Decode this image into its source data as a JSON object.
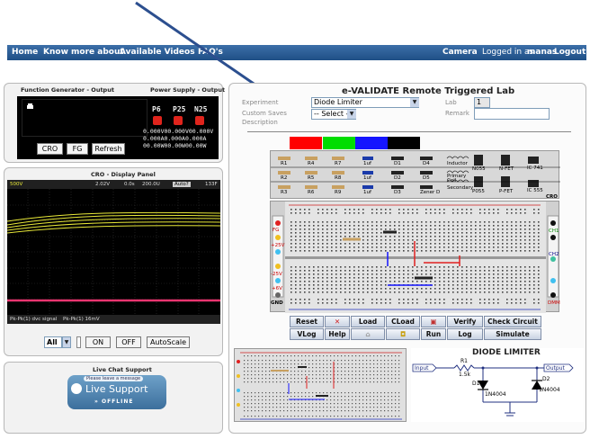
{
  "nav": {
    "home": "Home",
    "know_more": "Know more about",
    "videos": "Available Videos",
    "faq": "FAQ's",
    "camera": "Camera",
    "logged_prefix": "Logged in as",
    "user": "manas",
    "logout": "Logout"
  },
  "fg_panel": {
    "title": "Function Generator - Output",
    "ps_title": "Power Supply - Output",
    "cro_btn": "CRO",
    "fg_btn": "FG",
    "refresh_btn": "Refresh",
    "channels": [
      "P6",
      "P25",
      "N25"
    ],
    "readings": [
      [
        "0.000V",
        "00.000V",
        "00.000V"
      ],
      [
        "0.000A",
        "0.000A",
        "0.000A"
      ],
      [
        "00.00W",
        "00.00W",
        "00.00W"
      ]
    ]
  },
  "cro": {
    "title": "CRO - Display Panel",
    "header": [
      "500V",
      "2.02V",
      "0.0s",
      "200.0U",
      "Auto?",
      "133F"
    ],
    "footer_left": "Pk-Pk(1) dvc signal",
    "footer_right": "Pk-Pk(1) 16mV",
    "channel_select": "All",
    "on_btn": "ON",
    "off_btn": "OFF",
    "autoscale_btn": "AutoScale",
    "trace_yellow": "#e8e838",
    "trace_pink": "#e8356f"
  },
  "chat": {
    "title": "Live Chat Support",
    "leave_msg": "Please leave a message",
    "live_support": "Live Support",
    "offline": "OFFLINE"
  },
  "lab": {
    "title": "e-VALIDATE Remote Triggered Lab",
    "experiment_label": "Experiment",
    "experiment_value": "Diode Limiter",
    "lab_label": "Lab",
    "lab_value": "1",
    "custom_label": "Custom Saves",
    "custom_value": "-- Select --",
    "remark_label": "Remark",
    "description_label": "Description",
    "colors": [
      "#ff0000",
      "#00dd00",
      "#1515ff",
      "#000000"
    ]
  },
  "components": {
    "row1": [
      "R1",
      "R4",
      "R7",
      "1uf",
      "D1",
      "D4",
      "Inductor",
      "N055",
      "N-FET",
      "IC 741"
    ],
    "row2": [
      "R2",
      "R5",
      "R8",
      "1uf",
      "D2",
      "D5",
      "Primary Coil",
      "",
      "",
      "IC 555"
    ],
    "row2b": [
      "",
      "",
      "",
      "",
      "",
      "",
      "Secondary",
      "P055",
      "P-FET",
      ""
    ],
    "row3": [
      "R3",
      "R6",
      "R9",
      "1uf",
      "D3",
      "Zener D"
    ]
  },
  "board_labels": {
    "cro": "CRO",
    "fg": "FG",
    "p25": "+25V",
    "n25": "-25V",
    "p6": "+6V",
    "gnd": "GND",
    "ch1": "CH1",
    "ch2": "CH2",
    "dmm": "DMM"
  },
  "controls": {
    "row1": [
      "Reset",
      "",
      "Load",
      "CLoad",
      "",
      "Verify",
      "Check Circuit"
    ],
    "row2": [
      "VLog",
      "Help",
      "",
      "",
      "Run",
      "Log",
      "Simulate"
    ]
  },
  "schematic": {
    "title": "DIODE LIMITER",
    "input": "Input",
    "output": "Output",
    "r1": "R1",
    "r1_val": "1.5k",
    "d1": "D1",
    "d1_val": "1N4004",
    "d2": "D2",
    "d2_val": "1N4004"
  }
}
